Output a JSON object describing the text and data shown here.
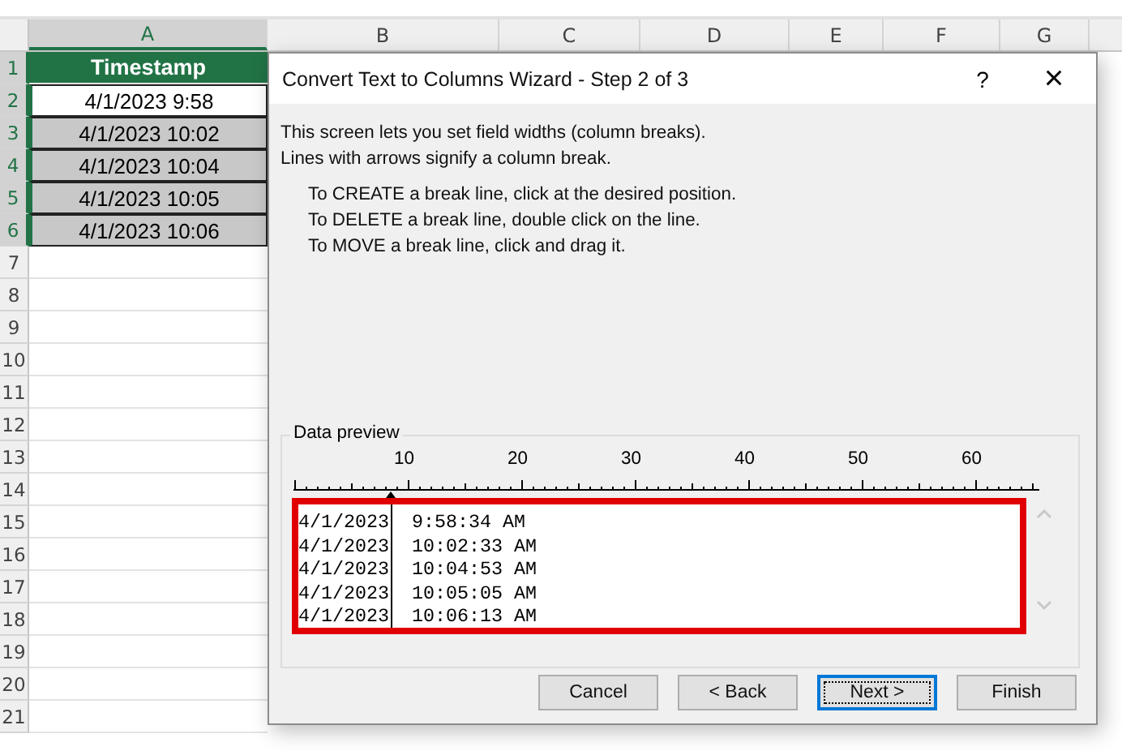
{
  "sheet": {
    "columns": [
      {
        "label": "A",
        "selected": true
      },
      {
        "label": "B",
        "selected": false
      },
      {
        "label": "C",
        "selected": false
      },
      {
        "label": "D",
        "selected": false
      },
      {
        "label": "E",
        "selected": false
      },
      {
        "label": "F",
        "selected": false
      },
      {
        "label": "G",
        "selected": false
      }
    ],
    "rows": [
      {
        "label": "1",
        "selected": true,
        "kind": "header",
        "value": "Timestamp"
      },
      {
        "label": "2",
        "selected": true,
        "kind": "active",
        "value": "4/1/2023 9:58"
      },
      {
        "label": "3",
        "selected": true,
        "kind": "cell",
        "value": "4/1/2023 10:02"
      },
      {
        "label": "4",
        "selected": true,
        "kind": "cell",
        "value": "4/1/2023 10:04"
      },
      {
        "label": "5",
        "selected": true,
        "kind": "cell",
        "value": "4/1/2023 10:05"
      },
      {
        "label": "6",
        "selected": true,
        "kind": "cell",
        "value": "4/1/2023 10:06"
      },
      {
        "label": "7",
        "selected": false
      },
      {
        "label": "8",
        "selected": false
      },
      {
        "label": "9",
        "selected": false
      },
      {
        "label": "10",
        "selected": false
      },
      {
        "label": "11",
        "selected": false
      },
      {
        "label": "12",
        "selected": false
      },
      {
        "label": "13",
        "selected": false
      },
      {
        "label": "14",
        "selected": false
      },
      {
        "label": "15",
        "selected": false
      },
      {
        "label": "16",
        "selected": false
      },
      {
        "label": "17",
        "selected": false
      },
      {
        "label": "18",
        "selected": false
      },
      {
        "label": "19",
        "selected": false
      },
      {
        "label": "20",
        "selected": false
      },
      {
        "label": "21",
        "selected": false
      }
    ]
  },
  "dialog": {
    "title": "Convert Text to Columns Wizard - Step 2 of 3",
    "help": "?",
    "close": "×",
    "intro": [
      "This screen lets you set field widths (column breaks).",
      "Lines with arrows signify a column break."
    ],
    "instructions": [
      "To CREATE a break line, click at the desired position.",
      "To DELETE a break line, double click on the line.",
      "To MOVE a break line, click and drag it."
    ],
    "preview": {
      "label": "Data preview",
      "ruler_labels": [
        "10",
        "20",
        "30",
        "40",
        "50",
        "60"
      ],
      "lines": [
        [
          "4/1/2023",
          "9:58:34 AM"
        ],
        [
          "4/1/2023",
          "10:02:33 AM"
        ],
        [
          "4/1/2023",
          "10:04:53 AM"
        ],
        [
          "4/1/2023",
          "10:05:05 AM"
        ],
        [
          "4/1/2023",
          "10:06:13 AM"
        ]
      ]
    },
    "buttons": [
      {
        "label": "Cancel",
        "focused": false
      },
      {
        "label": "< Back",
        "focused": false
      },
      {
        "label": "Next >",
        "focused": true
      },
      {
        "label": "Finish",
        "focused": false
      }
    ]
  }
}
